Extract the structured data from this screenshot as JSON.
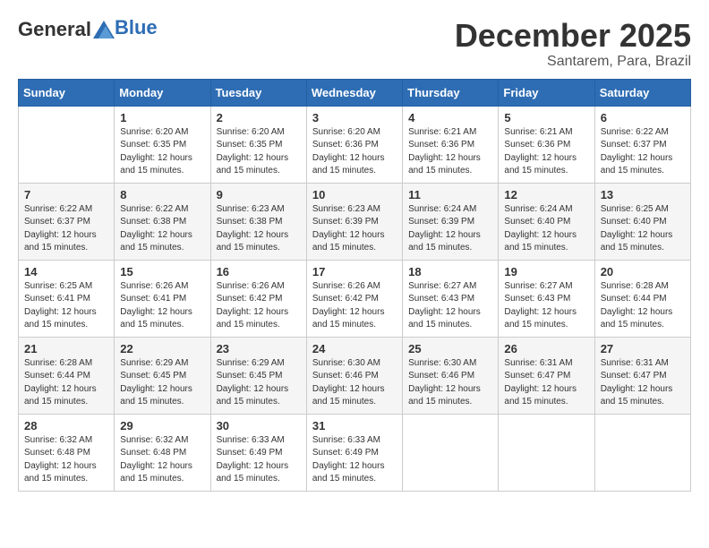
{
  "header": {
    "logo_general": "General",
    "logo_blue": "Blue",
    "month_title": "December 2025",
    "location": "Santarem, Para, Brazil"
  },
  "weekdays": [
    "Sunday",
    "Monday",
    "Tuesday",
    "Wednesday",
    "Thursday",
    "Friday",
    "Saturday"
  ],
  "weeks": [
    [
      {
        "day": "",
        "info": ""
      },
      {
        "day": "1",
        "info": "Sunrise: 6:20 AM\nSunset: 6:35 PM\nDaylight: 12 hours\nand 15 minutes."
      },
      {
        "day": "2",
        "info": "Sunrise: 6:20 AM\nSunset: 6:35 PM\nDaylight: 12 hours\nand 15 minutes."
      },
      {
        "day": "3",
        "info": "Sunrise: 6:20 AM\nSunset: 6:36 PM\nDaylight: 12 hours\nand 15 minutes."
      },
      {
        "day": "4",
        "info": "Sunrise: 6:21 AM\nSunset: 6:36 PM\nDaylight: 12 hours\nand 15 minutes."
      },
      {
        "day": "5",
        "info": "Sunrise: 6:21 AM\nSunset: 6:36 PM\nDaylight: 12 hours\nand 15 minutes."
      },
      {
        "day": "6",
        "info": "Sunrise: 6:22 AM\nSunset: 6:37 PM\nDaylight: 12 hours\nand 15 minutes."
      }
    ],
    [
      {
        "day": "7",
        "info": "Sunrise: 6:22 AM\nSunset: 6:37 PM\nDaylight: 12 hours\nand 15 minutes."
      },
      {
        "day": "8",
        "info": "Sunrise: 6:22 AM\nSunset: 6:38 PM\nDaylight: 12 hours\nand 15 minutes."
      },
      {
        "day": "9",
        "info": "Sunrise: 6:23 AM\nSunset: 6:38 PM\nDaylight: 12 hours\nand 15 minutes."
      },
      {
        "day": "10",
        "info": "Sunrise: 6:23 AM\nSunset: 6:39 PM\nDaylight: 12 hours\nand 15 minutes."
      },
      {
        "day": "11",
        "info": "Sunrise: 6:24 AM\nSunset: 6:39 PM\nDaylight: 12 hours\nand 15 minutes."
      },
      {
        "day": "12",
        "info": "Sunrise: 6:24 AM\nSunset: 6:40 PM\nDaylight: 12 hours\nand 15 minutes."
      },
      {
        "day": "13",
        "info": "Sunrise: 6:25 AM\nSunset: 6:40 PM\nDaylight: 12 hours\nand 15 minutes."
      }
    ],
    [
      {
        "day": "14",
        "info": "Sunrise: 6:25 AM\nSunset: 6:41 PM\nDaylight: 12 hours\nand 15 minutes."
      },
      {
        "day": "15",
        "info": "Sunrise: 6:26 AM\nSunset: 6:41 PM\nDaylight: 12 hours\nand 15 minutes."
      },
      {
        "day": "16",
        "info": "Sunrise: 6:26 AM\nSunset: 6:42 PM\nDaylight: 12 hours\nand 15 minutes."
      },
      {
        "day": "17",
        "info": "Sunrise: 6:26 AM\nSunset: 6:42 PM\nDaylight: 12 hours\nand 15 minutes."
      },
      {
        "day": "18",
        "info": "Sunrise: 6:27 AM\nSunset: 6:43 PM\nDaylight: 12 hours\nand 15 minutes."
      },
      {
        "day": "19",
        "info": "Sunrise: 6:27 AM\nSunset: 6:43 PM\nDaylight: 12 hours\nand 15 minutes."
      },
      {
        "day": "20",
        "info": "Sunrise: 6:28 AM\nSunset: 6:44 PM\nDaylight: 12 hours\nand 15 minutes."
      }
    ],
    [
      {
        "day": "21",
        "info": "Sunrise: 6:28 AM\nSunset: 6:44 PM\nDaylight: 12 hours\nand 15 minutes."
      },
      {
        "day": "22",
        "info": "Sunrise: 6:29 AM\nSunset: 6:45 PM\nDaylight: 12 hours\nand 15 minutes."
      },
      {
        "day": "23",
        "info": "Sunrise: 6:29 AM\nSunset: 6:45 PM\nDaylight: 12 hours\nand 15 minutes."
      },
      {
        "day": "24",
        "info": "Sunrise: 6:30 AM\nSunset: 6:46 PM\nDaylight: 12 hours\nand 15 minutes."
      },
      {
        "day": "25",
        "info": "Sunrise: 6:30 AM\nSunset: 6:46 PM\nDaylight: 12 hours\nand 15 minutes."
      },
      {
        "day": "26",
        "info": "Sunrise: 6:31 AM\nSunset: 6:47 PM\nDaylight: 12 hours\nand 15 minutes."
      },
      {
        "day": "27",
        "info": "Sunrise: 6:31 AM\nSunset: 6:47 PM\nDaylight: 12 hours\nand 15 minutes."
      }
    ],
    [
      {
        "day": "28",
        "info": "Sunrise: 6:32 AM\nSunset: 6:48 PM\nDaylight: 12 hours\nand 15 minutes."
      },
      {
        "day": "29",
        "info": "Sunrise: 6:32 AM\nSunset: 6:48 PM\nDaylight: 12 hours\nand 15 minutes."
      },
      {
        "day": "30",
        "info": "Sunrise: 6:33 AM\nSunset: 6:49 PM\nDaylight: 12 hours\nand 15 minutes."
      },
      {
        "day": "31",
        "info": "Sunrise: 6:33 AM\nSunset: 6:49 PM\nDaylight: 12 hours\nand 15 minutes."
      },
      {
        "day": "",
        "info": ""
      },
      {
        "day": "",
        "info": ""
      },
      {
        "day": "",
        "info": ""
      }
    ]
  ]
}
